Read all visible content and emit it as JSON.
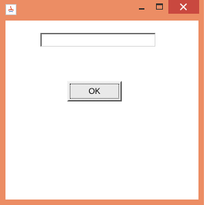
{
  "window": {
    "title": "",
    "controls": {
      "minimize_icon": "minimize-icon",
      "maximize_icon": "maximize-icon",
      "close_icon": "close-icon",
      "close_color": "#c9483f",
      "frame_color": "#ec8d64"
    }
  },
  "form": {
    "text_field": {
      "value": "",
      "placeholder": ""
    },
    "ok_label": "OK"
  }
}
